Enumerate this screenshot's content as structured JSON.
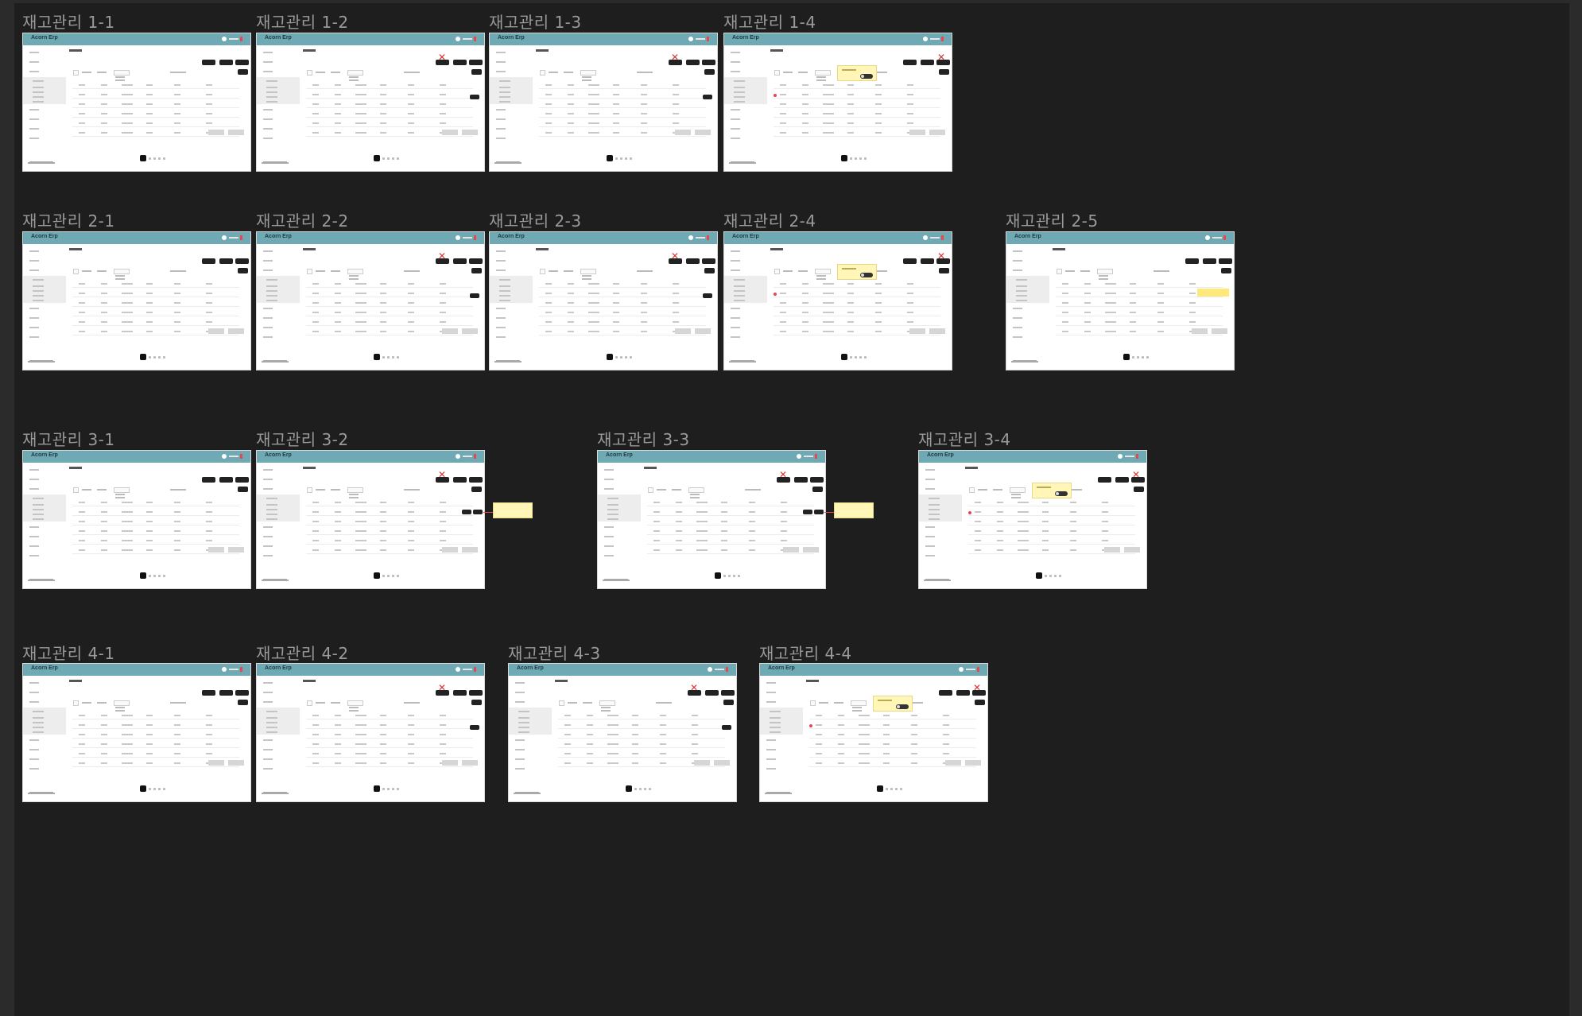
{
  "frames": [
    {
      "title": "재고관리 1-1",
      "variant": "base"
    },
    {
      "title": "재고관리 1-2",
      "variant": "delete"
    },
    {
      "title": "재고관리 1-3",
      "variant": "edit"
    },
    {
      "title": "재고관리 1-4",
      "variant": "popup"
    },
    {
      "title": "재고관리 2-1",
      "variant": "base"
    },
    {
      "title": "재고관리 2-2",
      "variant": "delete"
    },
    {
      "title": "재고관리 2-3",
      "variant": "edit"
    },
    {
      "title": "재고관리 2-4",
      "variant": "popup"
    },
    {
      "title": "재고관리 2-5",
      "variant": "highlight"
    },
    {
      "title": "재고관리 3-1",
      "variant": "base"
    },
    {
      "title": "재고관리 3-2",
      "variant": "external"
    },
    {
      "title": "재고관리 3-3",
      "variant": "external"
    },
    {
      "title": "재고관리 3-4",
      "variant": "popup"
    },
    {
      "title": "재고관리 4-1",
      "variant": "base"
    },
    {
      "title": "재고관리 4-2",
      "variant": "delete"
    },
    {
      "title": "재고관리 4-3",
      "variant": "edit"
    },
    {
      "title": "재고관리 4-4",
      "variant": "popup"
    }
  ],
  "colors": {
    "canvas_bg": "#1e1e1e",
    "frame_title": "#9a9a9a",
    "topbar": "#6fa9b4",
    "note": "#fff6b8",
    "accent_red": "#e5484d"
  },
  "frame_common": {
    "brand": "Acorn Erp"
  }
}
